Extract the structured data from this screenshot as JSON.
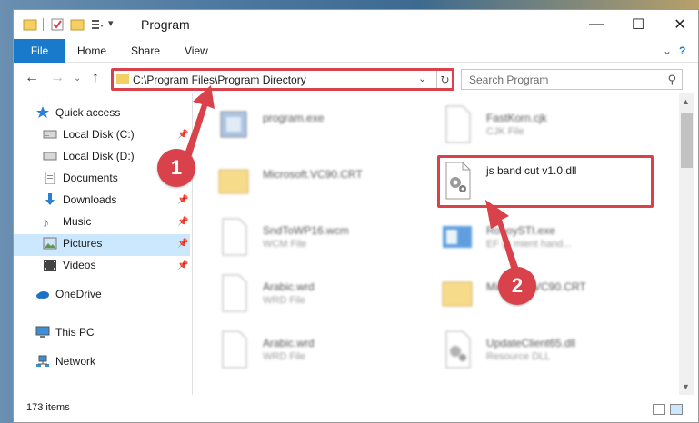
{
  "window": {
    "title": "Program",
    "controls": {
      "minimize": "—",
      "maximize": "☐",
      "close": "✕"
    }
  },
  "ribbon": {
    "tabs": [
      "File",
      "Home",
      "Share",
      "View"
    ]
  },
  "address_bar": {
    "path": "C:\\Program Files\\Program Directory",
    "search_placeholder": "Search Program"
  },
  "sidebar": {
    "items": [
      {
        "label": "Quick access",
        "icon": "star-icon",
        "pinned": false
      },
      {
        "label": "Local Disk (C:)",
        "icon": "drive-icon",
        "pinned": true
      },
      {
        "label": "Local Disk (D:)",
        "icon": "drive-icon",
        "pinned": true
      },
      {
        "label": "Documents",
        "icon": "documents-icon",
        "pinned": true
      },
      {
        "label": "Downloads",
        "icon": "download-icon",
        "pinned": true
      },
      {
        "label": "Music",
        "icon": "music-icon",
        "pinned": true
      },
      {
        "label": "Pictures",
        "icon": "pictures-icon",
        "pinned": true
      },
      {
        "label": "Videos",
        "icon": "videos-icon",
        "pinned": true
      },
      {
        "label": "OneDrive",
        "icon": "cloud-icon",
        "pinned": false
      },
      {
        "label": "This PC",
        "icon": "computer-icon",
        "pinned": false
      },
      {
        "label": "Network",
        "icon": "network-icon",
        "pinned": false
      }
    ],
    "selected": "This PC"
  },
  "files": [
    {
      "name": "program.exe",
      "type": "",
      "icon": "application-icon"
    },
    {
      "name": "FastKorn.cjk",
      "type": "CJK File",
      "icon": "file-icon"
    },
    {
      "name": "Microsoft.VC90.CRT",
      "type": "",
      "icon": "folder-icon"
    },
    {
      "name": "js band cut v1.0.dll",
      "type": "",
      "icon": "dll-gear-icon"
    },
    {
      "name": "SndToWP16.wcm",
      "type": "WCM File",
      "icon": "file-icon"
    },
    {
      "name": "RoboySTI.exe",
      "type": "EF (6 mient hand...",
      "icon": "application-icon"
    },
    {
      "name": "Arabic.wrd",
      "type": "WRD File",
      "icon": "file-icon"
    },
    {
      "name": "Microsoft.VC90.CRT",
      "type": "",
      "icon": "folder-icon"
    },
    {
      "name": "Arabic.wrd",
      "type": "WRD File",
      "icon": "file-icon"
    },
    {
      "name": "UpdateClient65.dll",
      "type": "Resource DLL",
      "icon": "dll-gear-icon"
    }
  ],
  "status": {
    "item_count": "173 items"
  },
  "callouts": [
    "1",
    "2"
  ],
  "colors": {
    "accent": "#1979ca",
    "highlight": "#d9414b",
    "selection": "#cce8ff"
  }
}
